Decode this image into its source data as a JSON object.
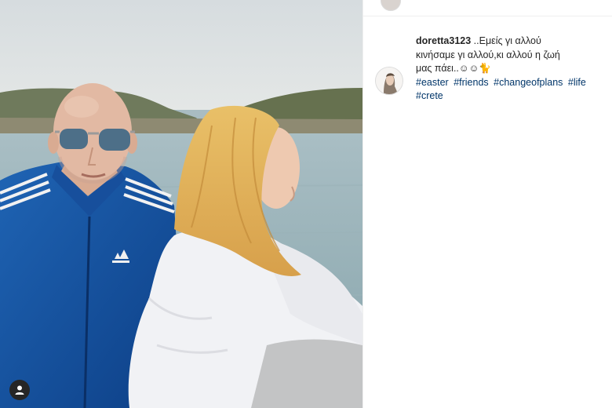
{
  "post": {
    "username": "doretta3123",
    "caption_lines": [
      "..Εμείς γι αλλού",
      "κινήσαμε γι αλλού,κι αλλού η ζωή",
      "μας πάει..☺☺🐈"
    ],
    "hashtags": [
      "#easter",
      "#friends",
      "#changeofplans",
      "#life",
      "#crete"
    ]
  },
  "icons": {
    "user_tag": "person-icon",
    "avatar": "profile-avatar"
  },
  "colors": {
    "hashtag": "#003569",
    "text": "#262626",
    "border": "#efefef"
  }
}
